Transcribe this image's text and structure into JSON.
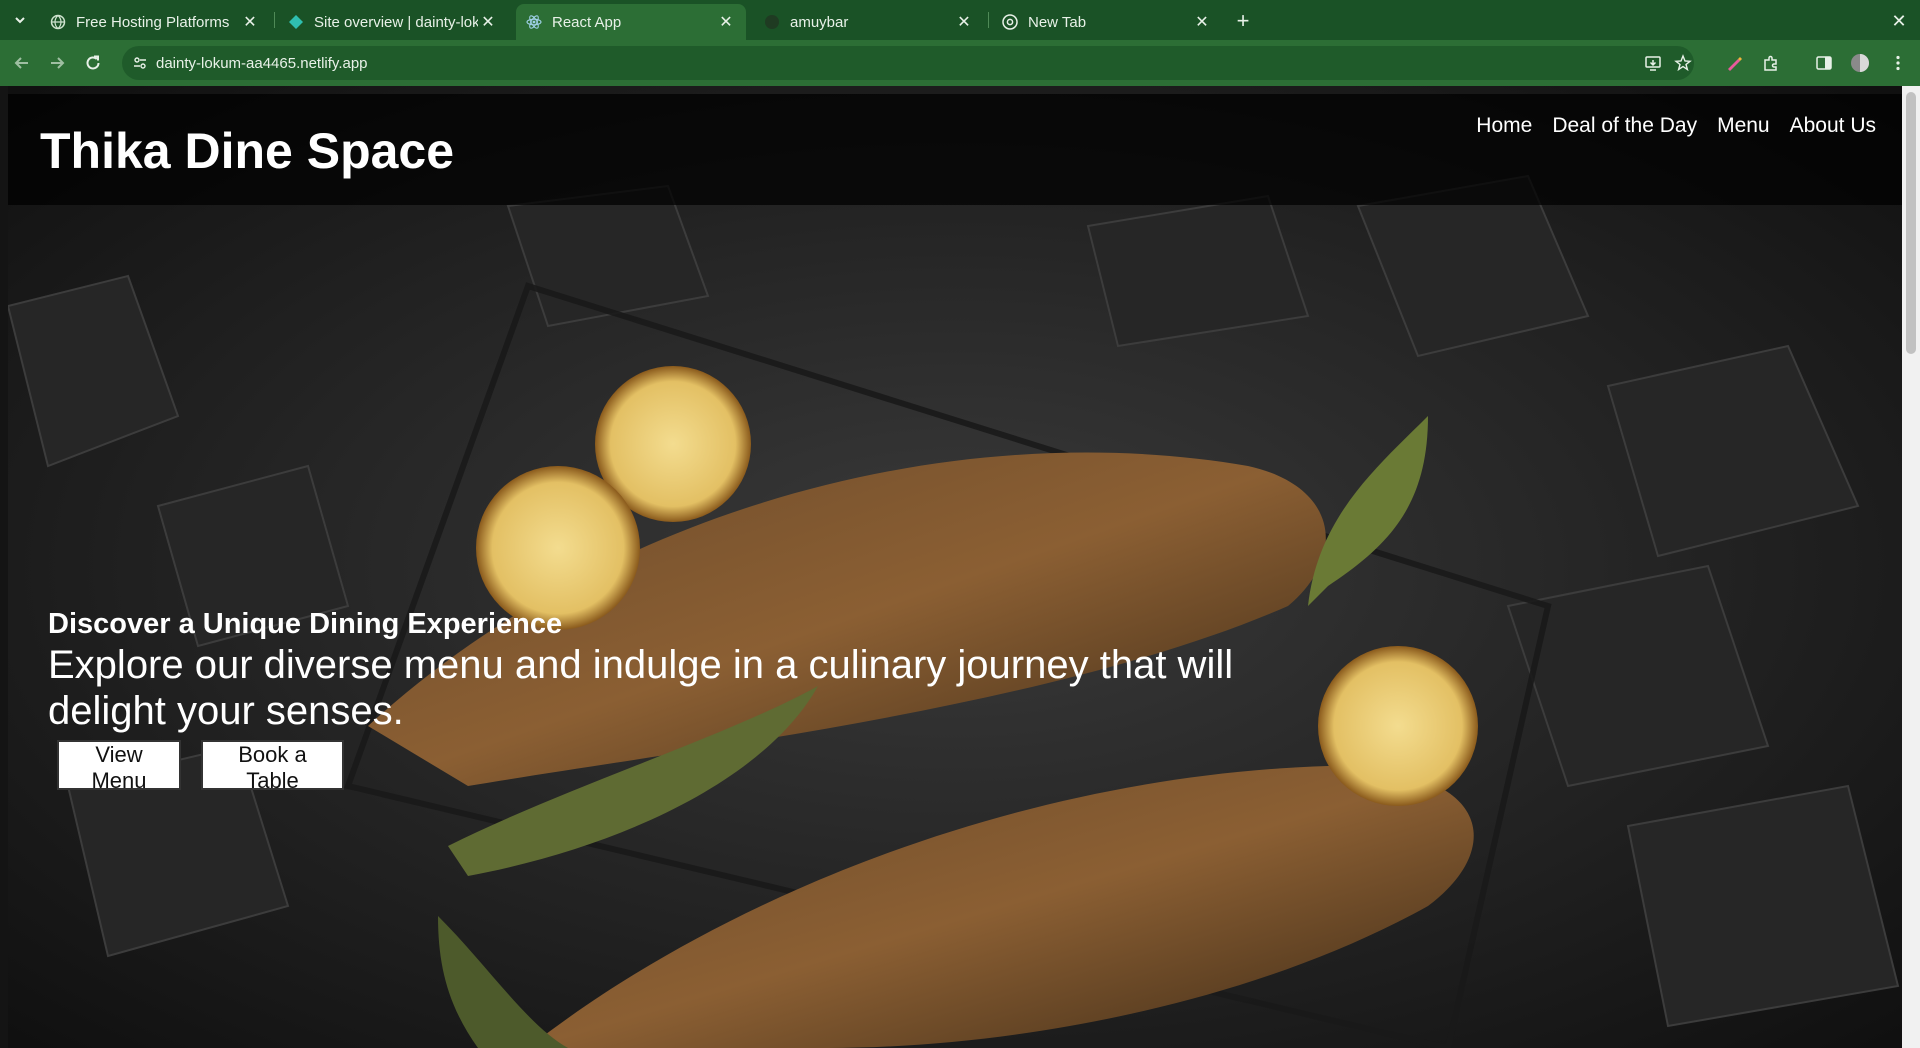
{
  "browser": {
    "tabs": [
      {
        "title": "Free Hosting Platforms",
        "active": false
      },
      {
        "title": "Site overview | dainty-lok",
        "active": false
      },
      {
        "title": "React App",
        "active": true
      },
      {
        "title": "amuybar",
        "active": false
      },
      {
        "title": "New Tab",
        "active": false
      }
    ],
    "url": "dainty-lokum-aa4465.netlify.app"
  },
  "site": {
    "brand": "Thika Dine Space",
    "nav": [
      "Home",
      "Deal of the Day",
      "Menu",
      "About Us"
    ]
  },
  "hero": {
    "heading": "Discover a Unique Dining Experience",
    "subtext": "Explore our diverse menu and indulge in a culinary journey that will delight your senses.",
    "buttons": [
      "View Menu",
      "Book a Table"
    ]
  },
  "colors": {
    "chrome_dark": "#1a5226",
    "chrome_active": "#2c6e35",
    "header_overlay": "rgba(0,0,0,0.72)"
  }
}
